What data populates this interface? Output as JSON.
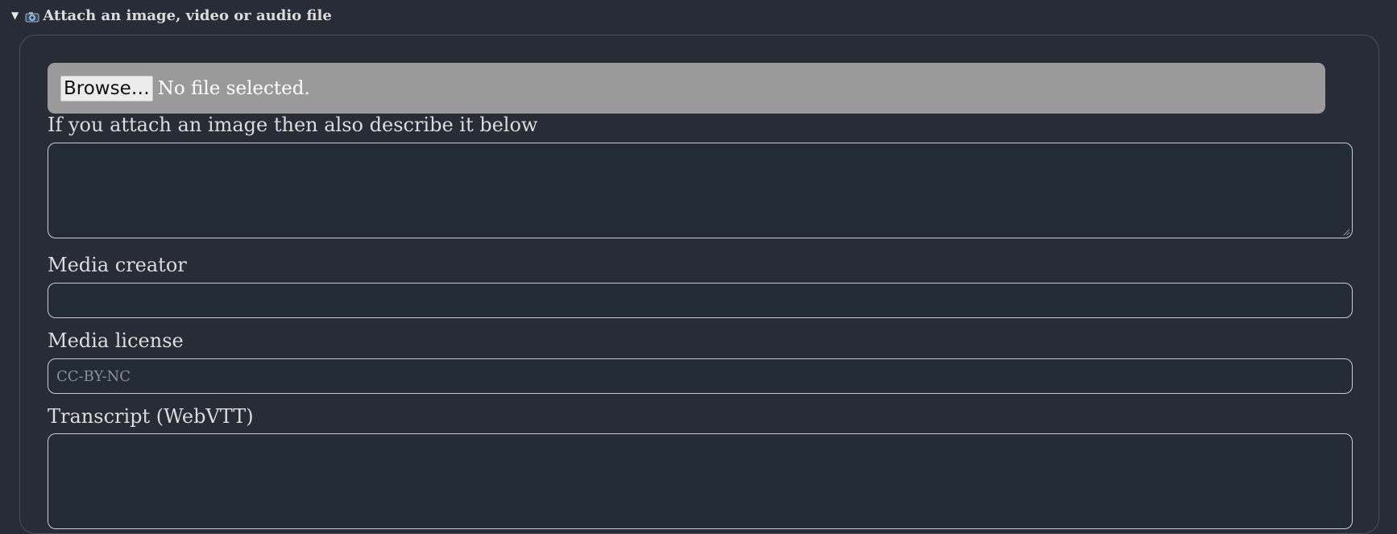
{
  "section": {
    "toggle_glyph": "▼",
    "icon": "camera-icon",
    "title": "Attach an image, video or audio file"
  },
  "file_picker": {
    "browse_label": "Browse…",
    "status": "No file selected."
  },
  "image_description": {
    "label": "If you attach an image then also describe it below",
    "value": ""
  },
  "media_creator": {
    "label": "Media creator",
    "value": ""
  },
  "media_license": {
    "label": "Media license",
    "placeholder": "CC-BY-NC",
    "value": ""
  },
  "transcript": {
    "label": "Transcript (WebVTT)",
    "value": ""
  },
  "colors": {
    "page_background": "#282c37",
    "field_background": "#222b36",
    "file_input_background": "#9a9a9a",
    "text": "#dcdcdc"
  }
}
